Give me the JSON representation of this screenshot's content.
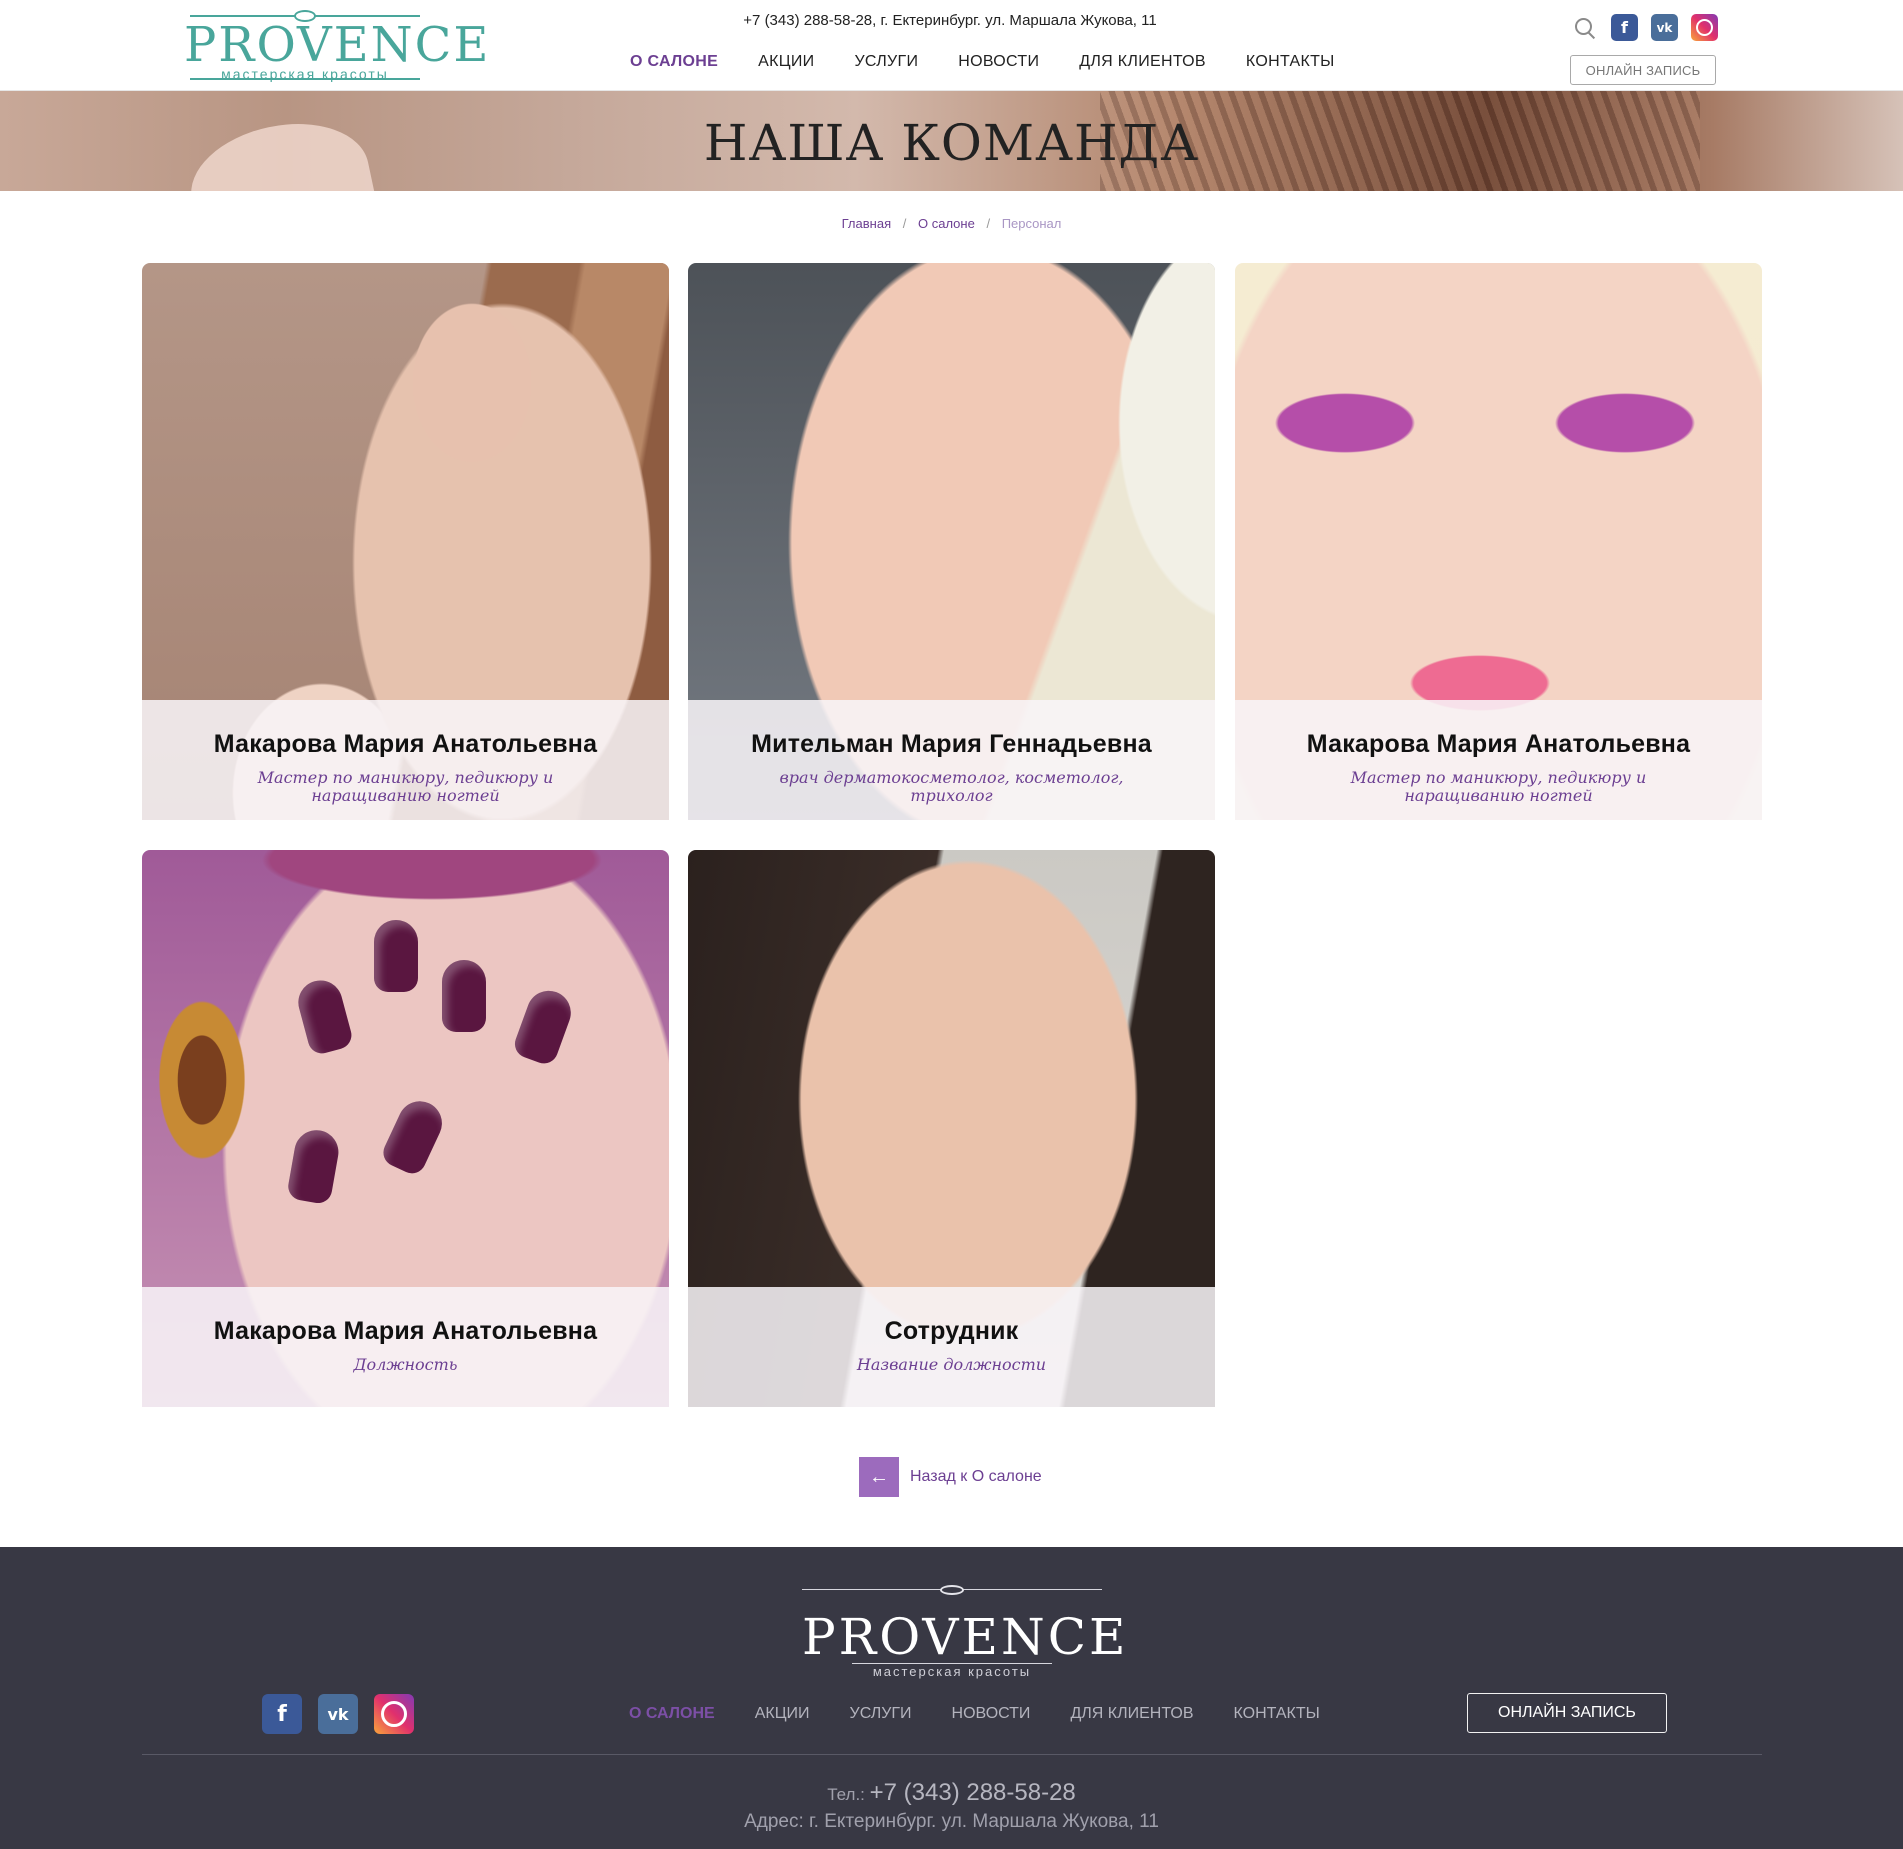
{
  "header": {
    "logo_word": "PROVENCE",
    "logo_sub": "мастерская красоты",
    "contact_line": "+7 (343) 288-58-28, г. Ектеринбург. ул. Маршала Жукова, 11",
    "nav": [
      "О САЛОНЕ",
      "АКЦИИ",
      "УСЛУГИ",
      "НОВОСТИ",
      "ДЛЯ КЛИЕНТОВ",
      "КОНТАКТЫ"
    ],
    "nav_active": "О САЛОНЕ",
    "icons": [
      "search-icon",
      "facebook-icon",
      "vk-icon",
      "instagram-icon"
    ],
    "book_button": "ОНЛАЙН ЗАПИСЬ"
  },
  "hero": {
    "title": "НАША КОМАНДА"
  },
  "breadcrumb": [
    "Главная",
    "О салоне",
    "Персонал"
  ],
  "team": [
    {
      "name": "Макарова Мария Анатольевна",
      "role": "Мастер по маникюру, педикюру и наращиванию ногтей"
    },
    {
      "name": "Мительман Мария Геннадьевна",
      "role": "врач дерматокосметолог, косметолог, трихолог"
    },
    {
      "name": "Макарова Мария Анатольевна",
      "role": "Мастер по маникюру, педикюру и наращиванию ногтей"
    },
    {
      "name": "Макарова Мария Анатольевна",
      "role": "Должность"
    },
    {
      "name": "Сотрудник",
      "role": "Название должности"
    }
  ],
  "back_link": "Назад к О салоне",
  "footer": {
    "logo_word": "PROVENCE",
    "logo_sub": "мастерская красоты",
    "nav": [
      "О САЛОНЕ",
      "АКЦИИ",
      "УСЛУГИ",
      "НОВОСТИ",
      "ДЛЯ КЛИЕНТОВ",
      "КОНТАКТЫ"
    ],
    "book_button": "ОНЛАЙН ЗАПИСЬ",
    "phone_label": "Тел.:",
    "phone": "+7 (343) 288-58-28",
    "address": "Адрес: г. Ектеринбург. ул. Маршала Жукова, 11"
  },
  "colors": {
    "accent": "#6c3f92",
    "logo": "#49a69b",
    "footer_bg": "#383844",
    "back_button": "#9c6bbd"
  }
}
